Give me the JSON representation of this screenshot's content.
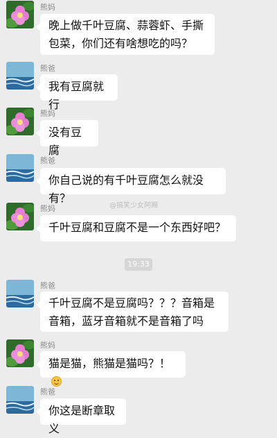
{
  "chat": {
    "names": {
      "mom": "熊妈",
      "dad": "熊爸"
    },
    "messages": [
      {
        "text": "晚上做千叶豆腐、蒜蓉虾、手撕包菜，你们还有啥想吃的吗？"
      },
      {
        "text": "我有豆腐就行"
      },
      {
        "text": "没有豆腐"
      },
      {
        "text": "你自己说的有千叶豆腐怎么就没有？"
      },
      {
        "text": "千叶豆腐和豆腐不是一个东西好吧？"
      },
      {
        "text": "千叶豆腐不是豆腐吗？？？音箱是音箱，蓝牙音箱就不是音箱了吗"
      },
      {
        "text": "猫是猫，熊猫是猫吗？！",
        "emoji": "smile-emoji"
      },
      {
        "text": "你这是断章取义"
      }
    ],
    "timestamp": "19:33",
    "watermark": "@搞笑少女阿赐"
  }
}
